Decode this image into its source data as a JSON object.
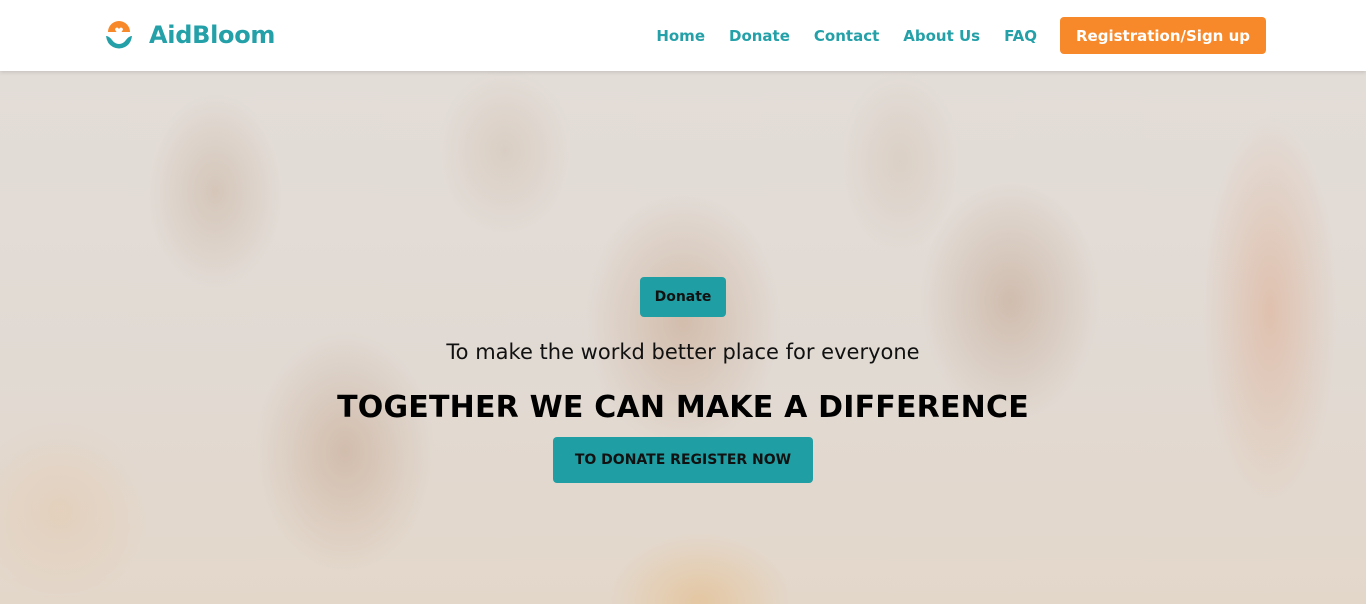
{
  "brand": {
    "name": "AidBloom",
    "logo_icon": "hands-heart-icon"
  },
  "nav": {
    "links": [
      "Home",
      "Donate",
      "Contact",
      "About Us",
      "FAQ"
    ],
    "signup_label": "Registration/Sign up"
  },
  "hero": {
    "donate_label": "Donate",
    "tagline": "To make the workd better place for everyone",
    "title": "TOGETHER WE CAN MAKE A DIFFERENCE",
    "cta_label": "TO DONATE REGISTER NOW"
  },
  "colors": {
    "accent": "#23a0a8",
    "button_teal": "#1f9ea3",
    "signup_orange": "#f7892a"
  }
}
